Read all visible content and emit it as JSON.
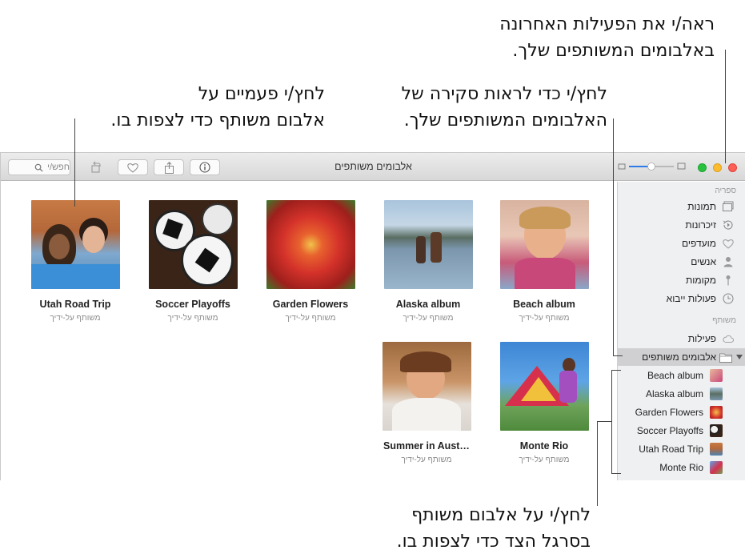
{
  "callouts": {
    "activity": [
      "ראה/י את הפעילות האחרונה",
      "באלבומים המשותפים שלך."
    ],
    "overview": [
      "לחץ/י כדי לראות סקירה של",
      "האלבומים המשותפים שלך."
    ],
    "double_click": [
      "לחץ/י פעמיים על",
      "אלבום משותף כדי לצפות בו."
    ],
    "sidebar_click": [
      "לחץ/י על אלבום משותף",
      "בסרגל הצד כדי לצפות בו."
    ]
  },
  "window": {
    "title": "אלבומים משותפים",
    "search_placeholder": "חפש/י"
  },
  "sidebar": {
    "library_heading": "ספריה",
    "library_items": [
      {
        "label": "תמונות",
        "icon": "photos-icon"
      },
      {
        "label": "זיכרונות",
        "icon": "memories-icon"
      },
      {
        "label": "מועדפים",
        "icon": "heart-icon"
      },
      {
        "label": "אנשים",
        "icon": "person-icon"
      },
      {
        "label": "מקומות",
        "icon": "pin-icon"
      },
      {
        "label": "פעולות ייבוא",
        "icon": "clock-icon"
      }
    ],
    "shared_heading": "משותף",
    "activity_label": "פעילות",
    "shared_albums_label": "אלבומים משותפים",
    "shared_albums": [
      {
        "label": "Beach album",
        "color": "#d98a9a"
      },
      {
        "label": "Alaska album",
        "color": "#6f8fa8"
      },
      {
        "label": "Garden Flowers",
        "color": "#d6402e"
      },
      {
        "label": "Soccer Playoffs",
        "color": "#6b4a3a"
      },
      {
        "label": "Utah Road Trip",
        "color": "#b56a3c"
      },
      {
        "label": "Monte Rio",
        "color": "#6aa0d8"
      }
    ]
  },
  "albums": [
    {
      "name": "Utah Road Trip",
      "sub": "משותף על-ידיך"
    },
    {
      "name": "Soccer Playoffs",
      "sub": "משותף על-ידיך"
    },
    {
      "name": "Garden Flowers",
      "sub": "משותף על-ידיך"
    },
    {
      "name": "Alaska album",
      "sub": "משותף על-ידיך"
    },
    {
      "name": "Beach album",
      "sub": "משותף על-ידיך"
    },
    {
      "name": "Summer in Aust…",
      "sub": "משותף על-ידיך"
    },
    {
      "name": "Monte Rio",
      "sub": "משותף על-ידיך"
    }
  ]
}
